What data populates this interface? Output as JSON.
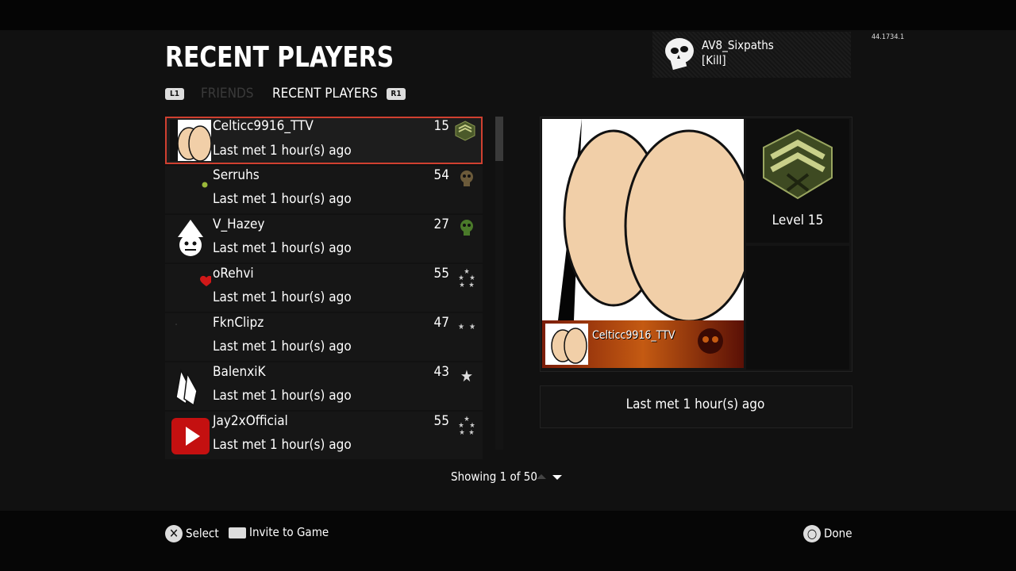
{
  "build": "44.1734.1",
  "title": "RECENT PLAYERS",
  "user": {
    "gamertag": "AV8_Sixpaths",
    "clan": "[Kill]"
  },
  "tabs": {
    "left_button": "L1",
    "friends": "FRIENDS",
    "recent": "RECENT PLAYERS",
    "right_button": "R1"
  },
  "players": [
    {
      "name": "Celticc9916_TTV",
      "level": "15",
      "last_met": "Last met 1 hour(s) ago",
      "avatar": "emblem-skin-icon",
      "rank": "sergeant-rank-icon"
    },
    {
      "name": "Serruhs",
      "level": "54",
      "last_met": "Last met 1 hour(s) ago",
      "avatar": "online-dot-icon",
      "rank": "skull-rank-icon"
    },
    {
      "name": "V_Hazey",
      "level": "27",
      "last_met": "Last met 1 hour(s) ago",
      "avatar": "clown-face-icon",
      "rank": "skull-green-rank-icon"
    },
    {
      "name": "oRehvi",
      "level": "55",
      "last_met": "Last met 1 hour(s) ago",
      "avatar": "heart-icon",
      "rank": "stars-rank-icon"
    },
    {
      "name": "FknClipz",
      "level": "47",
      "last_met": "Last met 1 hour(s) ago",
      "avatar": "blank-emblem-icon",
      "rank": "two-stars-rank-icon"
    },
    {
      "name": "BalenxiK",
      "level": "43",
      "last_met": "Last met 1 hour(s) ago",
      "avatar": "praying-hands-icon",
      "rank": "star-rank-icon"
    },
    {
      "name": "Jay2xOfficial",
      "level": "55",
      "last_met": "Last met 1 hour(s) ago",
      "avatar": "play-button-icon",
      "rank": "stars-rank-icon"
    }
  ],
  "detail": {
    "calling_card_name": "Celticc9916_TTV",
    "level_label": "Level 15",
    "last_met": "Last met 1 hour(s) ago"
  },
  "pagination": {
    "showing": "Showing 1 of 50"
  },
  "footer": {
    "select": "Select",
    "invite": "Invite to Game",
    "done": "Done"
  },
  "colors": {
    "selection_border": "#d04030",
    "background": "#111111"
  }
}
